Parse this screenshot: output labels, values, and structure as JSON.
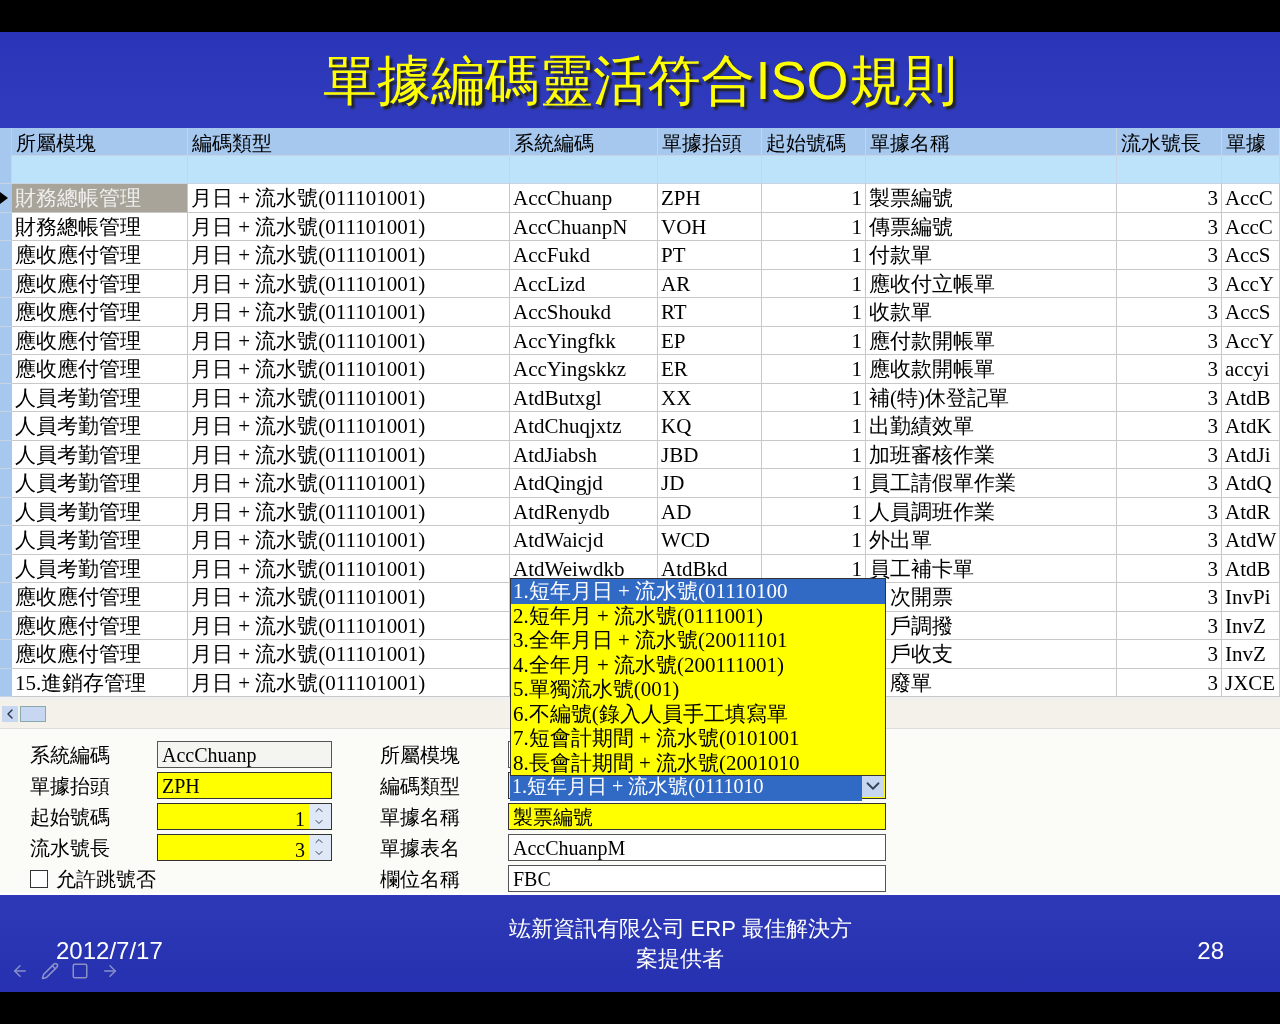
{
  "slide": {
    "title": "單據編碼靈活符合ISO規則",
    "date": "2012/7/17",
    "company": "竑新資訊有限公司  ERP 最佳解決方案提供者",
    "page": "28"
  },
  "grid": {
    "columns": [
      {
        "label": "所屬模塊",
        "kind": "text"
      },
      {
        "label": "編碼類型",
        "kind": "text"
      },
      {
        "label": "系統編碼",
        "kind": "text"
      },
      {
        "label": "單據抬頭",
        "kind": "text"
      },
      {
        "label": "起始號碼",
        "kind": "number"
      },
      {
        "label": "單據名稱",
        "kind": "text"
      },
      {
        "label": "流水號長",
        "kind": "number"
      },
      {
        "label": "單據",
        "kind": "text"
      }
    ],
    "rows": [
      {
        "selected": true,
        "cells": [
          "財務總帳管理",
          "月日 + 流水號(011101001)",
          "AccChuanp",
          "ZPH",
          "1",
          "製票編號",
          "3",
          "AccC"
        ]
      },
      {
        "selected": false,
        "cells": [
          "財務總帳管理",
          "月日 + 流水號(011101001)",
          "AccChuanpN",
          "VOH",
          "1",
          "傳票編號",
          "3",
          "AccC"
        ]
      },
      {
        "selected": false,
        "cells": [
          "應收應付管理",
          "月日 + 流水號(011101001)",
          "AccFukd",
          "PT",
          "1",
          "付款單",
          "3",
          "AccS"
        ]
      },
      {
        "selected": false,
        "cells": [
          "應收應付管理",
          "月日 + 流水號(011101001)",
          "AccLizd",
          "AR",
          "1",
          "應收付立帳單",
          "3",
          "AccY"
        ]
      },
      {
        "selected": false,
        "cells": [
          "應收應付管理",
          "月日 + 流水號(011101001)",
          "AccShoukd",
          "RT",
          "1",
          "收款單",
          "3",
          "AccS"
        ]
      },
      {
        "selected": false,
        "cells": [
          "應收應付管理",
          "月日 + 流水號(011101001)",
          "AccYingfkk",
          "EP",
          "1",
          "應付款開帳單",
          "3",
          "AccY"
        ]
      },
      {
        "selected": false,
        "cells": [
          "應收應付管理",
          "月日 + 流水號(011101001)",
          "AccYingskkz",
          "ER",
          "1",
          "應收款開帳單",
          "3",
          "accyi"
        ]
      },
      {
        "selected": false,
        "cells": [
          "人員考勤管理",
          "月日 + 流水號(011101001)",
          "AtdButxgl",
          "XX",
          "1",
          "補(特)休登記單",
          "3",
          "AtdB"
        ]
      },
      {
        "selected": false,
        "cells": [
          "人員考勤管理",
          "月日 + 流水號(011101001)",
          "AtdChuqjxtz",
          "KQ",
          "1",
          "出勤績效單",
          "3",
          "AtdK"
        ]
      },
      {
        "selected": false,
        "cells": [
          "人員考勤管理",
          "月日 + 流水號(011101001)",
          "AtdJiabsh",
          "JBD",
          "1",
          "加班審核作業",
          "3",
          "AtdJi"
        ]
      },
      {
        "selected": false,
        "cells": [
          "人員考勤管理",
          "月日 + 流水號(011101001)",
          "AtdQingjd",
          "JD",
          "1",
          "員工請假單作業",
          "3",
          "AtdQ"
        ]
      },
      {
        "selected": false,
        "cells": [
          "人員考勤管理",
          "月日 + 流水號(011101001)",
          "AtdRenydb",
          "AD",
          "1",
          "人員調班作業",
          "3",
          "AtdR"
        ]
      },
      {
        "selected": false,
        "cells": [
          "人員考勤管理",
          "月日 + 流水號(011101001)",
          "AtdWaicjd",
          "WCD",
          "1",
          "外出單",
          "3",
          "AtdW"
        ]
      },
      {
        "selected": false,
        "cells": [
          "人員考勤管理",
          "月日 + 流水號(011101001)",
          "AtdWeiwdkb",
          "AtdBkd",
          "1",
          "員工補卡單",
          "3",
          "AtdB"
        ]
      },
      {
        "selected": false,
        "cells": [
          "應收應付管理",
          "月日 + 流水號(011101001)",
          null,
          null,
          null,
          "次開票",
          "3",
          "InvPi"
        ]
      },
      {
        "selected": false,
        "cells": [
          "應收應付管理",
          "月日 + 流水號(011101001)",
          null,
          null,
          null,
          "戶調撥",
          "3",
          "InvZ"
        ]
      },
      {
        "selected": false,
        "cells": [
          "應收應付管理",
          "月日 + 流水號(011101001)",
          null,
          null,
          null,
          "戶收支",
          "3",
          "InvZ"
        ]
      },
      {
        "selected": false,
        "cells": [
          "15.進銷存管理",
          "月日 + 流水號(011101001)",
          null,
          null,
          null,
          "廢單",
          "3",
          "JXCE"
        ]
      }
    ]
  },
  "dropdown": {
    "options": [
      {
        "label": "1.短年月日 + 流水號(01110100",
        "selected": true
      },
      {
        "label": "2.短年月 + 流水號(0111001)",
        "selected": false
      },
      {
        "label": "3.全年月日 + 流水號(20011101",
        "selected": false
      },
      {
        "label": "4.全年月 + 流水號(200111001)",
        "selected": false
      },
      {
        "label": "5.單獨流水號(001)",
        "selected": false
      },
      {
        "label": "6.不編號(錄入人員手工填寫單",
        "selected": false
      },
      {
        "label": "7.短會計期間 + 流水號(0101001",
        "selected": false
      },
      {
        "label": "8.長會計期間 + 流水號(2001010",
        "selected": false
      }
    ]
  },
  "form": {
    "left": [
      {
        "label": "系統編碼",
        "kind": "readonly",
        "value": "AccChuanp"
      },
      {
        "label": "單據抬頭",
        "kind": "required",
        "value": "ZPH"
      },
      {
        "label": "起始號碼",
        "kind": "spinner",
        "value": "1"
      },
      {
        "label": "流水號長",
        "kind": "spinner",
        "value": "3"
      },
      {
        "label": "允許跳號否",
        "kind": "checkbox",
        "checked": false
      }
    ],
    "right": [
      {
        "label": "所屬模塊",
        "kind": "text"
      },
      {
        "label": "編碼類型",
        "kind": "combo",
        "value": "1.短年月日 + 流水號(0111010"
      },
      {
        "label": "單據名稱",
        "kind": "required",
        "value": "製票編號"
      },
      {
        "label": "單據表名",
        "kind": "text",
        "value": "AccChuanpM"
      },
      {
        "label": "欄位名稱",
        "kind": "text",
        "value": "FBC"
      }
    ]
  }
}
